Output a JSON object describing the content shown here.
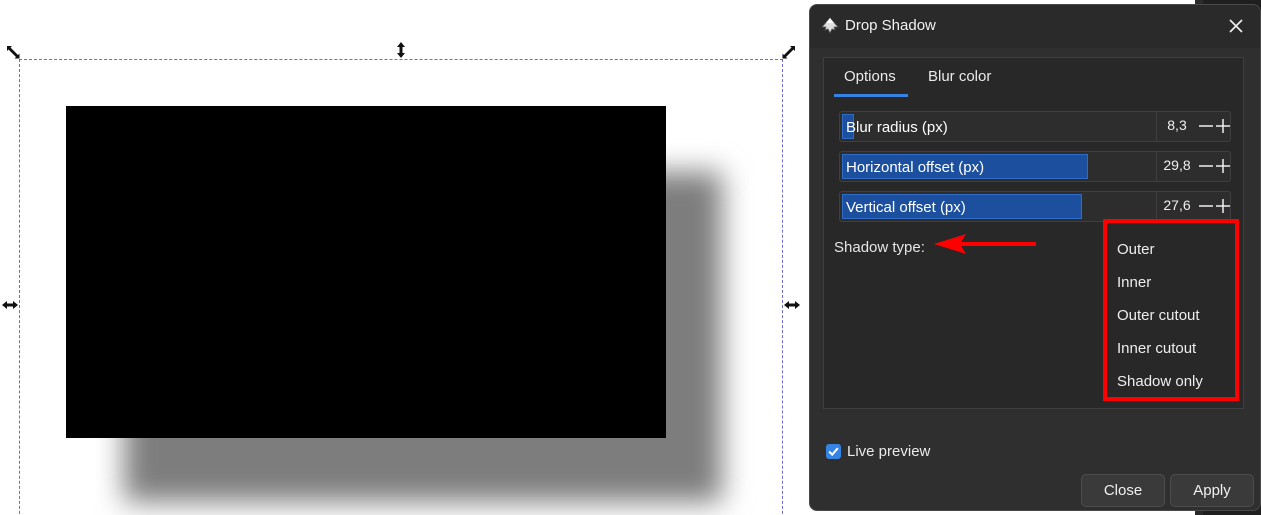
{
  "canvas": {
    "rect_color": "#000000",
    "shadow_color": "#7d7d7d"
  },
  "dialog": {
    "title": "Drop Shadow",
    "close_icon": "close-icon",
    "tabs": [
      {
        "label": "Options",
        "active": true
      },
      {
        "label": "Blur color",
        "active": false
      }
    ],
    "sliders": [
      {
        "label": "Blur radius (px)",
        "value": "8,3",
        "fill_fraction": 0.03
      },
      {
        "label": "Horizontal offset (px)",
        "value": "29,8",
        "fill_fraction": 0.79
      },
      {
        "label": "Vertical offset (px)",
        "value": "27,6",
        "fill_fraction": 0.77
      }
    ],
    "shadow_type_label": "Shadow type:",
    "shadow_types": [
      "Outer",
      "Inner",
      "Outer cutout",
      "Inner cutout",
      "Shadow only"
    ],
    "live_preview": {
      "label": "Live preview",
      "checked": true
    },
    "buttons": {
      "close": "Close",
      "apply": "Apply"
    }
  },
  "colors": {
    "accent": "#3584e4",
    "slider_fill": "#1c4f9e",
    "annotation": "#ff0000"
  }
}
